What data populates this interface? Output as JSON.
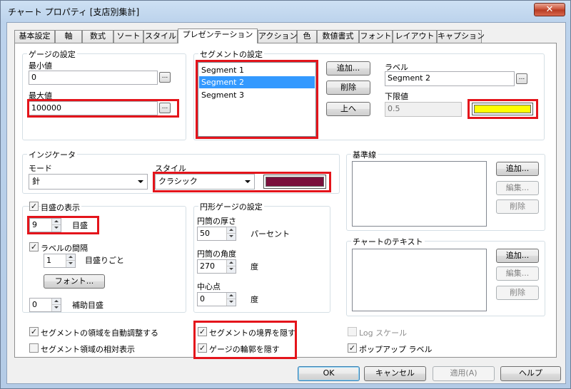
{
  "window": {
    "title": "チャート プロパティ [支店別集計]",
    "close_glyph": "✕"
  },
  "tabs": [
    {
      "label": "基本設定"
    },
    {
      "label": "軸"
    },
    {
      "label": "数式"
    },
    {
      "label": "ソート"
    },
    {
      "label": "スタイル"
    },
    {
      "label": "プレゼンテーション"
    },
    {
      "label": "アクション"
    },
    {
      "label": "色"
    },
    {
      "label": "数値書式"
    },
    {
      "label": "フォント"
    },
    {
      "label": "レイアウト"
    },
    {
      "label": "キャプション"
    }
  ],
  "active_tab": "プレゼンテーション",
  "gauge_settings": {
    "title": "ゲージの設定",
    "min_label": "最小値",
    "min_value": "0",
    "max_label": "最大値",
    "max_value": "100000",
    "ellipsis": "..."
  },
  "segment_settings": {
    "title": "セグメントの設定",
    "segments": [
      "Segment 1",
      "Segment 2",
      "Segment 3"
    ],
    "selected_index": 1,
    "add_button": "追加...",
    "delete_button": "削除",
    "up_button": "上へ",
    "label_caption": "ラベル",
    "label_value": "Segment 2",
    "lower_limit_caption": "下限値",
    "lower_limit_value": "0.5",
    "segment_color": "#ffff00"
  },
  "indicator": {
    "title": "インジケータ",
    "mode_label": "モード",
    "mode_value": "針",
    "style_label": "スタイル",
    "style_value": "クラシック",
    "indicator_color": "#7a0f3c"
  },
  "tickmarks": {
    "show_label": "目盛の表示",
    "show_checked": true,
    "count_value": "9",
    "count_unit": "目盛",
    "label_interval_label": "ラベルの間隔",
    "label_interval_checked": true,
    "interval_value": "1",
    "interval_unit": "目盛りごと",
    "font_button": "フォント...",
    "minor_value": "0",
    "minor_label": "補助目盛"
  },
  "cylinder": {
    "title": "円形ゲージの設定",
    "thickness_label": "円筒の厚さ",
    "thickness_value": "50",
    "thickness_unit": "パーセント",
    "angle_label": "円筒の角度",
    "angle_value": "270",
    "angle_unit": "度",
    "center_label": "中心点",
    "center_value": "0",
    "center_unit": "度"
  },
  "reference_lines": {
    "title": "基準線",
    "add": "追加...",
    "edit": "編集...",
    "delete": "削除"
  },
  "chart_text": {
    "title": "チャートのテキスト",
    "add": "追加...",
    "edit": "編集...",
    "delete": "削除"
  },
  "options": {
    "autofit_segments": {
      "label": "セグメントの領域を自動調整する",
      "checked": true
    },
    "relative_segments": {
      "label": "セグメント領域の相対表示",
      "checked": false
    },
    "hide_boundaries": {
      "label": "セグメントの境界を隠す",
      "checked": true
    },
    "hide_outlines": {
      "label": "ゲージの輪郭を隠す",
      "checked": true
    },
    "log_scale": {
      "label": "Log スケール",
      "checked": false,
      "enabled": false
    },
    "popup_labels": {
      "label": "ポップアップ ラベル",
      "checked": true
    }
  },
  "footer": {
    "ok": "OK",
    "cancel": "キャンセル",
    "apply": "適用(A)",
    "help": "ヘルプ"
  },
  "highlight_color": "#e4141b"
}
